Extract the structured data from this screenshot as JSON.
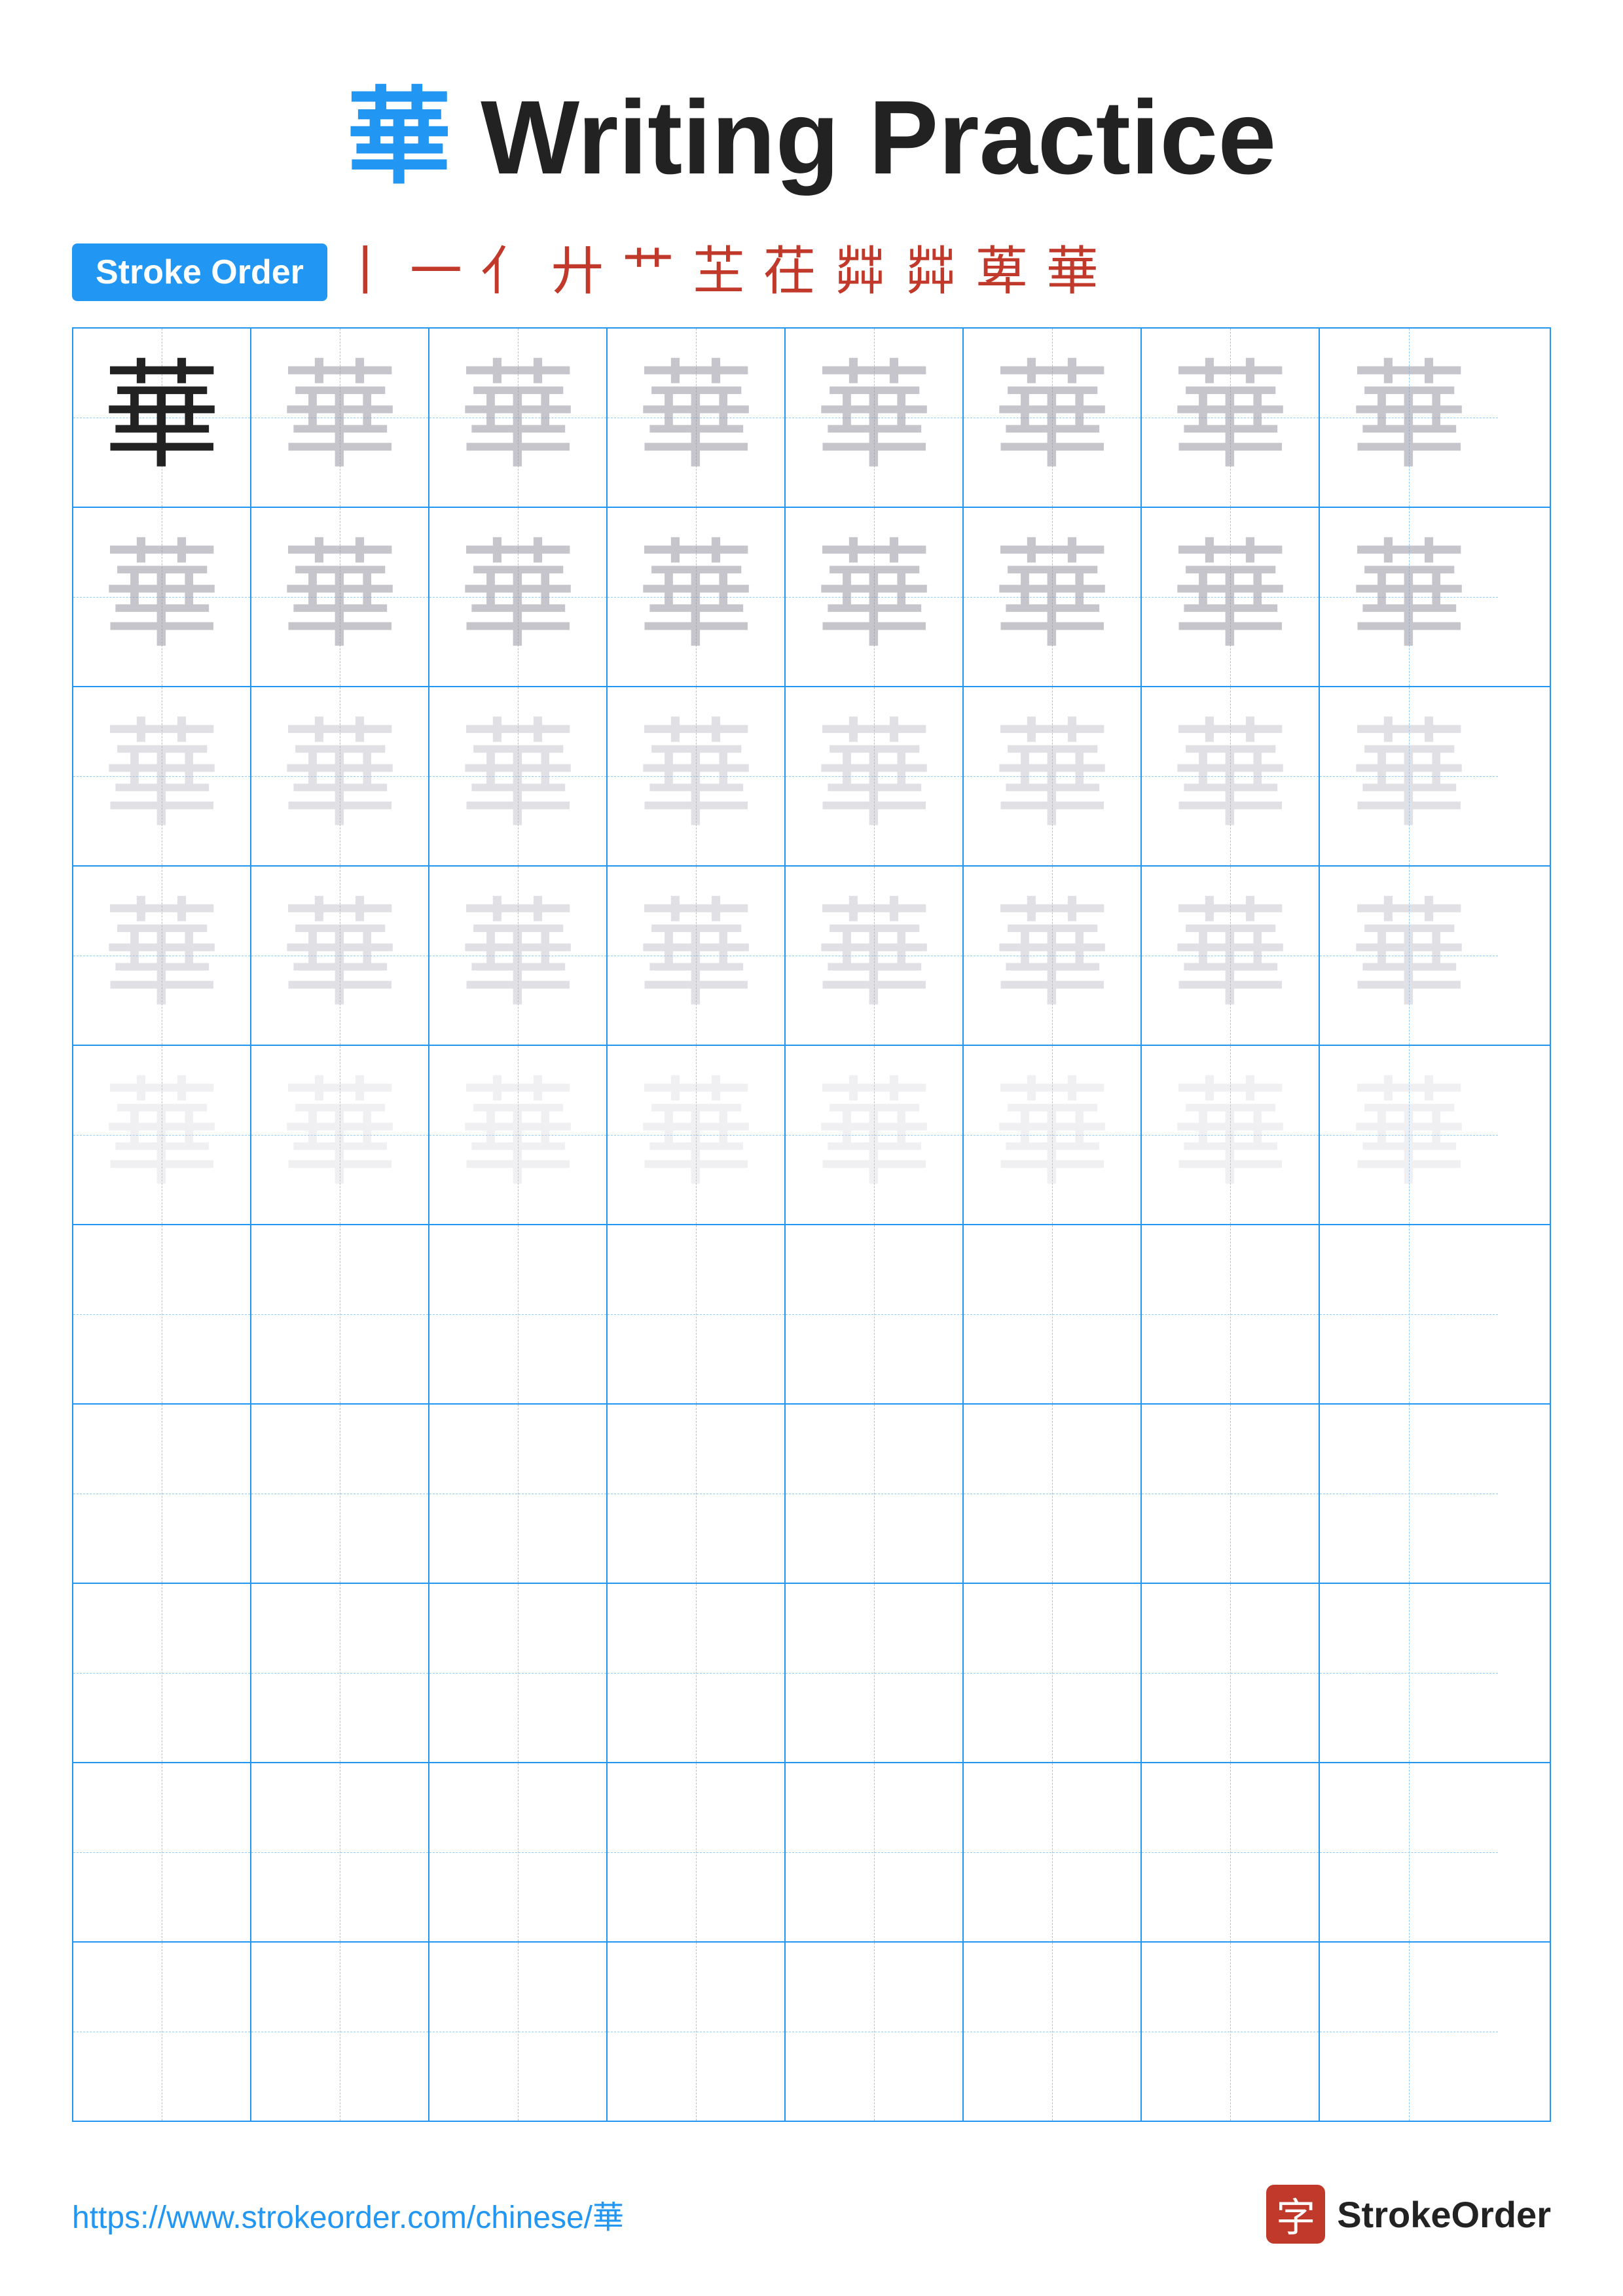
{
  "title": {
    "char": "華",
    "text": " Writing Practice"
  },
  "stroke_order": {
    "badge": "Stroke Order",
    "chars": [
      "丨",
      "一",
      "亻",
      "廾",
      "艹",
      "芏",
      "茌",
      "茻",
      "茻",
      "萆",
      "華"
    ]
  },
  "grid": {
    "rows": 10,
    "cols": 8,
    "char": "華",
    "practice_char": "華"
  },
  "footer": {
    "url": "https://www.strokeorder.com/chinese/華",
    "logo_char": "字",
    "logo_text": "StrokeOrder"
  }
}
